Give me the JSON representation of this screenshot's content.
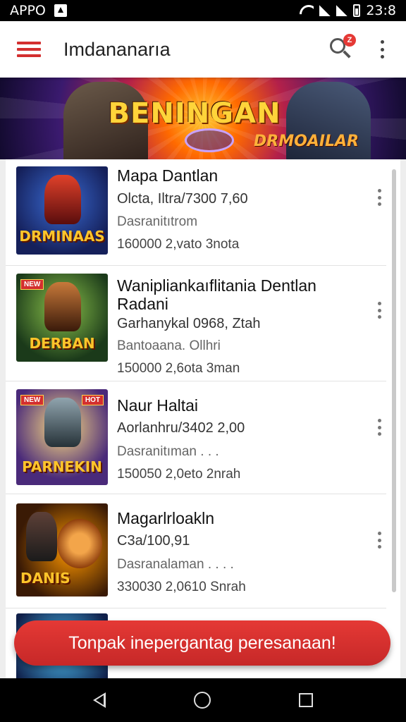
{
  "status_bar": {
    "app_label": "APPO",
    "time": "23:8"
  },
  "app_bar": {
    "title": "Imdananarıa"
  },
  "banner": {
    "title": "BENINGAN",
    "subtitle": "DRMOAILAR"
  },
  "items": [
    {
      "title": "Mapa Dantlan",
      "line2": "Olcta, Iltra/7300 7,60",
      "line3": "Dasranitıtrom",
      "stats": "160000   2,vato 3nota",
      "thumb_logo": "DRMINAAS"
    },
    {
      "title": "Wanipliankaıflitania Dentlan Radani",
      "line2": "Garhanykal 0968, Ztah",
      "line3": "Bantoaana. Ollhri",
      "stats": "150000   2,6ota 3man",
      "thumb_logo": "DERBAN"
    },
    {
      "title": "Naur Haltai",
      "line2": "Aorlanhru/3402 2,00",
      "line3": "Dasranitıman . . .",
      "stats": "150050   2,0eto 2nrah",
      "thumb_logo": "PARNEKIN"
    },
    {
      "title": "Magarlrloakln",
      "line2": "C3a/100,91",
      "line3": "Dasranalaman . . . .",
      "stats": "330030   2,0610 Snrah",
      "thumb_logo": "DANIS"
    }
  ],
  "cta": {
    "label": "Tonpak inepergantag peresanaan!"
  },
  "colors": {
    "accent": "#d32f2f",
    "cta": "#e53935"
  },
  "icons": [
    "menu-icon",
    "search-icon",
    "overflow-menu-icon",
    "back-icon",
    "home-icon",
    "recent-apps-icon"
  ]
}
